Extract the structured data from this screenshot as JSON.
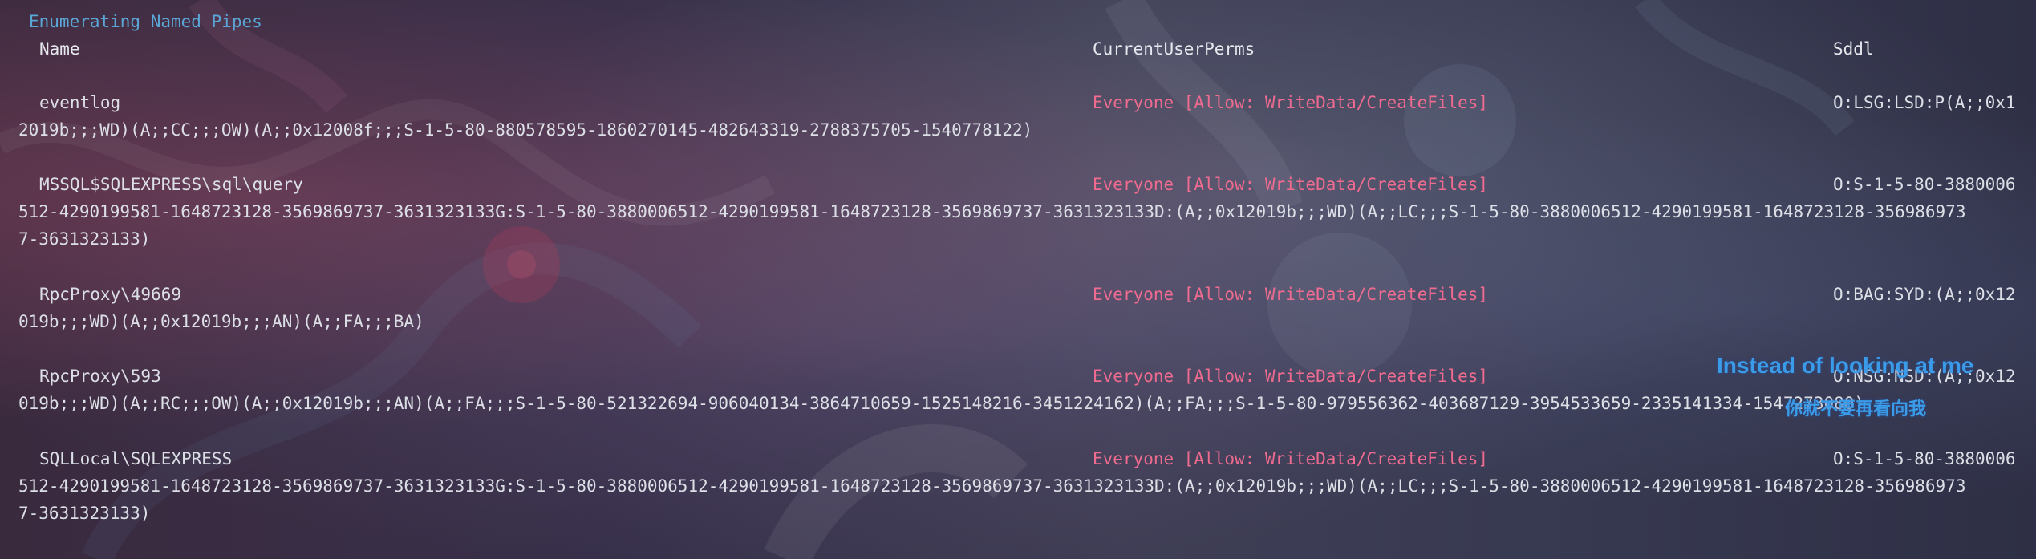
{
  "terminal": {
    "title": "Enumerating Named Pipes",
    "headers": {
      "name": "Name",
      "perms": "CurrentUserPerms",
      "sddl": "Sddl"
    },
    "rows": [
      {
        "name": "eventlog",
        "perms": "Everyone [Allow: WriteData/CreateFiles]",
        "sddl_start": "O:LSG:LSD:P(A;;0x1",
        "sddl_cont1": "2019b;;;WD)(A;;CC;;;OW)(A;;0x12008f;;;S-1-5-80-880578595-1860270145-482643319-2788375705-1540778122)"
      },
      {
        "name": "MSSQL$SQLEXPRESS\\sql\\query",
        "perms": "Everyone [Allow: WriteData/CreateFiles]",
        "sddl_start": "O:S-1-5-80-3880006",
        "sddl_cont1": "512-4290199581-1648723128-3569869737-3631323133G:S-1-5-80-3880006512-4290199581-1648723128-3569869737-3631323133D:(A;;0x12019b;;;WD)(A;;LC;;;S-1-5-80-3880006512-4290199581-1648723128-356986973",
        "sddl_cont2": "7-3631323133)"
      },
      {
        "name": "RpcProxy\\49669",
        "perms": "Everyone [Allow: WriteData/CreateFiles]",
        "sddl_start": "O:BAG:SYD:(A;;0x12",
        "sddl_cont1": "019b;;;WD)(A;;0x12019b;;;AN)(A;;FA;;;BA)"
      },
      {
        "name": "RpcProxy\\593",
        "perms": "Everyone [Allow: WriteData/CreateFiles]",
        "sddl_start": "O:NSG:NSD:(A;;0x12",
        "sddl_cont1": "019b;;;WD)(A;;RC;;;OW)(A;;0x12019b;;;AN)(A;;FA;;;S-1-5-80-521322694-906040134-3864710659-1525148216-3451224162)(A;;FA;;;S-1-5-80-979556362-403687129-3954533659-2335141334-1547273080)"
      },
      {
        "name": "SQLLocal\\SQLEXPRESS",
        "perms": "Everyone [Allow: WriteData/CreateFiles]",
        "sddl_start": "O:S-1-5-80-3880006",
        "sddl_cont1": "512-4290199581-1648723128-3569869737-3631323133G:S-1-5-80-3880006512-4290199581-1648723128-3569869737-3631323133D:(A;;0x12019b;;;WD)(A;;LC;;;S-1-5-80-3880006512-4290199581-1648723128-356986973",
        "sddl_cont2": "7-3631323133)"
      }
    ]
  },
  "overlay": {
    "title": "Instead of looking at me",
    "subtitle": "你就不要再看向我"
  },
  "colors": {
    "title": "#5aa6d6",
    "perm": "#ef6b8f",
    "text": "#dcdfe6",
    "overlay": "#3a9be8"
  }
}
